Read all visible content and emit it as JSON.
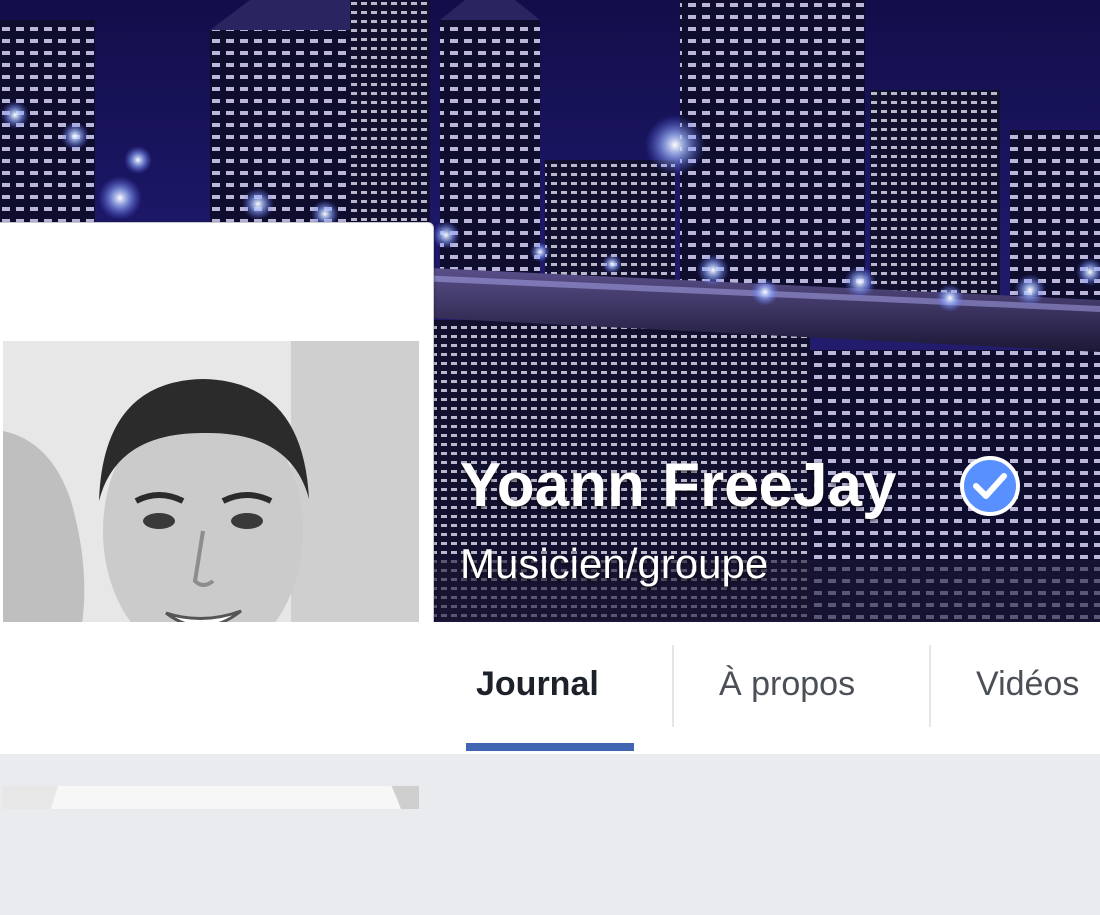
{
  "profile": {
    "name": "Yoann FreeJay",
    "category": "Musicien/groupe",
    "verified": true,
    "verified_badge_color": "#5890ff"
  },
  "tabs": [
    {
      "label": "Journal",
      "active": true
    },
    {
      "label": "À propos",
      "active": false
    },
    {
      "label": "Vidéos",
      "active": false
    }
  ],
  "colors": {
    "accent": "#4267b2",
    "background": "#e9ebee"
  }
}
